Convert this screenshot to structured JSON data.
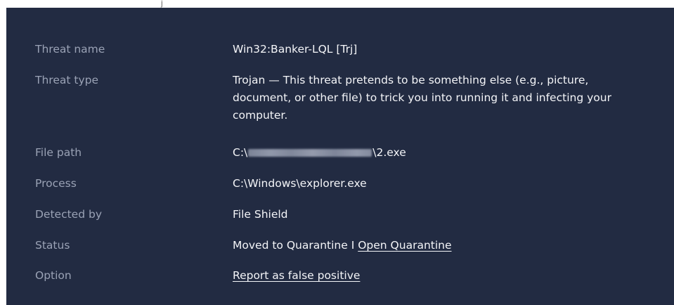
{
  "top_strip": {
    "glyph": "j"
  },
  "details": {
    "threat_name": {
      "label": "Threat name",
      "value": "Win32:Banker-LQL [Trj]"
    },
    "threat_type": {
      "label": "Threat type",
      "value": "Trojan — This threat pretends to be something else (e.g., picture, document, or other file) to trick you into running it and infecting your computer."
    },
    "file_path": {
      "label": "File path",
      "prefix": "C:\\",
      "suffix": "\\2.exe"
    },
    "process": {
      "label": "Process",
      "value": "C:\\Windows\\explorer.exe"
    },
    "detected_by": {
      "label": "Detected by",
      "value": "File Shield"
    },
    "status": {
      "label": "Status",
      "value": "Moved to Quarantine",
      "separator": " I ",
      "link": "Open Quarantine"
    },
    "option": {
      "label": "Option",
      "link": "Report as false positive"
    }
  }
}
